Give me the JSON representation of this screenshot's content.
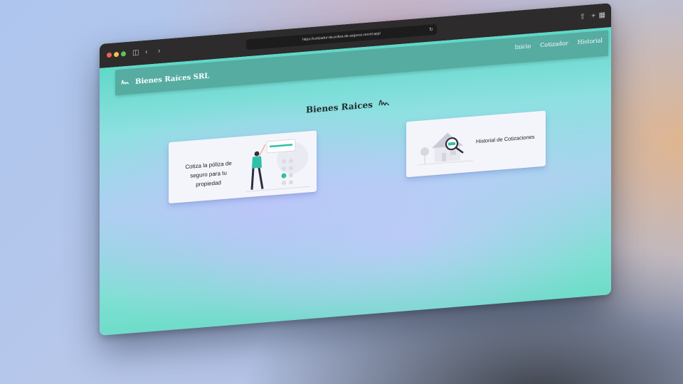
{
  "browser": {
    "url": "https://cotizador-de-poliza-de-seguros.vercel.app/"
  },
  "navbar": {
    "brand": "Bienes Raíces SRL",
    "links": [
      {
        "label": "Inicio"
      },
      {
        "label": "Cotizador"
      },
      {
        "label": "Historial"
      }
    ]
  },
  "main": {
    "title": "Bienes Raices"
  },
  "cards": {
    "quote": {
      "label": "Cotiza la póliza de seguro para tu propiedad"
    },
    "history": {
      "label": "Historial de Cotizaciones"
    }
  },
  "colors": {
    "accent": "#2ebfa5",
    "navbar": "#56aca1"
  }
}
